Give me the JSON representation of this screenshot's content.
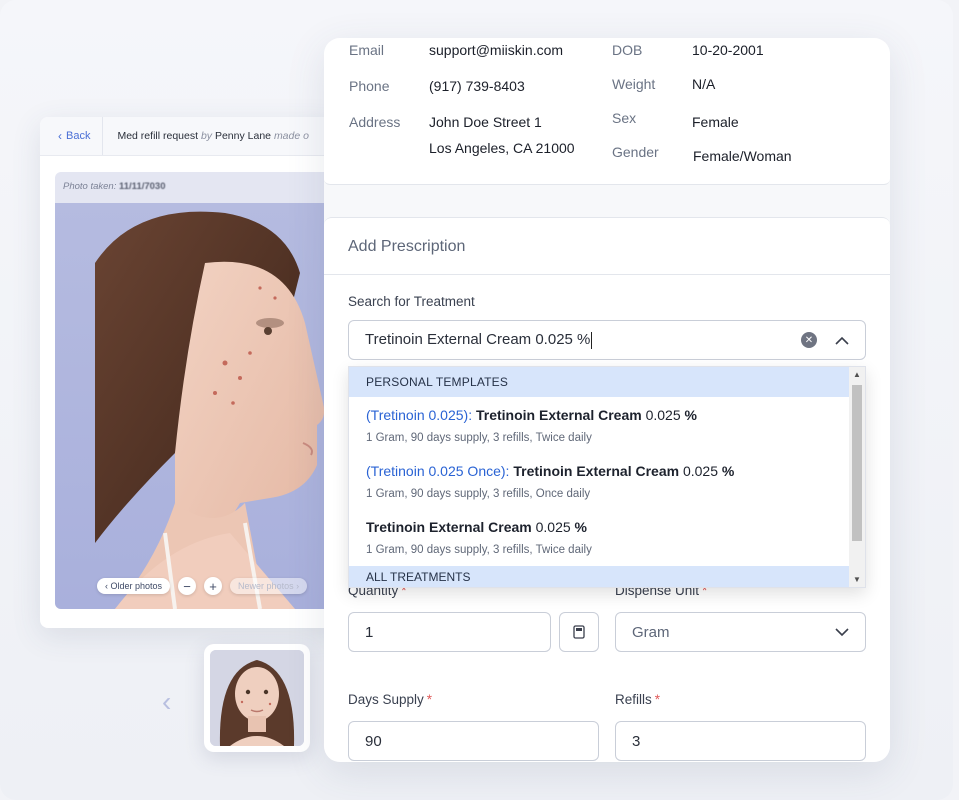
{
  "photo_card": {
    "back_label": "Back",
    "request_prefix": "Med refill request",
    "request_by": "by",
    "request_name": "Penny Lane",
    "request_suffix": "made o",
    "photo_taken_label": "Photo taken:",
    "photo_taken_value": "11/11/7030",
    "older_photos": "Older photos",
    "newer_photos": "Newer photos",
    "zoom_out": "−",
    "zoom_in": "+"
  },
  "patient": {
    "email_label": "Email",
    "email": "support@miiskin.com",
    "phone_label": "Phone",
    "phone": "(917) 739-8403",
    "address_label": "Address",
    "address_line1": "John Doe Street 1",
    "address_line2": "Los Angeles, CA 21000",
    "dob_label": "DOB",
    "dob": "10-20-2001",
    "weight_label": "Weight",
    "weight": "N/A",
    "sex_label": "Sex",
    "sex": "Female",
    "gender_label": "Gender",
    "gender": "Female/Woman"
  },
  "prescription": {
    "title": "Add Prescription",
    "search_label": "Search for Treatment",
    "search_value": "Tretinoin External Cream 0.025 %",
    "dropdown": {
      "personal_header": "PERSONAL TEMPLATES",
      "all_header": "ALL TREATMENTS",
      "items": [
        {
          "template": "(Tretinoin 0.025):",
          "name": "Tretinoin External Cream",
          "strength": "0.025",
          "unit": "%",
          "details": "1 Gram, 90 days supply, 3 refills, Twice daily"
        },
        {
          "template": "(Tretinoin 0.025 Once):",
          "name": "Tretinoin External Cream",
          "strength": "0.025",
          "unit": "%",
          "details": "1 Gram, 90 days supply, 3 refills, Once daily"
        },
        {
          "template": "",
          "name": "Tretinoin External Cream",
          "strength": "0.025",
          "unit": "%",
          "details": "1 Gram, 90 days supply, 3 refills, Twice daily"
        }
      ]
    },
    "quantity_label": "Quantity",
    "quantity_value": "1",
    "dispense_unit_label": "Dispense Unit",
    "dispense_unit_value": "Gram",
    "days_supply_label": "Days Supply",
    "days_supply_value": "90",
    "refills_label": "Refills",
    "refills_value": "3",
    "required_mark": "*"
  },
  "colors": {
    "accent": "#2a63d4",
    "dropdown_header_bg": "#d7e5fb",
    "required": "#e05a5a"
  }
}
